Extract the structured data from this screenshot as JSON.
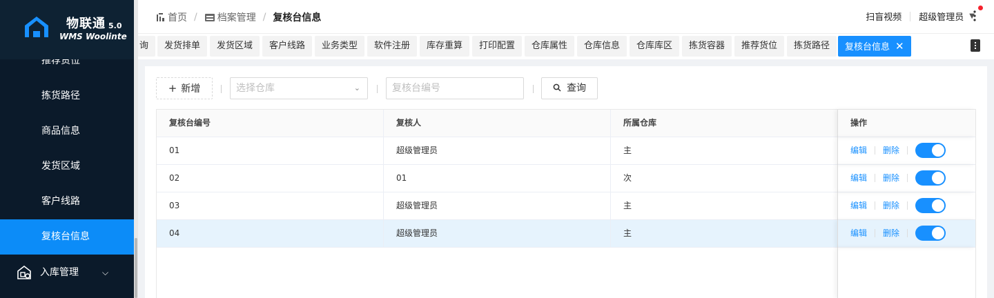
{
  "brand": {
    "name_cn": "物联通",
    "version": "5.0",
    "name_en": "WMS Woolinte"
  },
  "sidebar": {
    "items": [
      {
        "label": "推荐货位"
      },
      {
        "label": "拣货路径"
      },
      {
        "label": "商品信息"
      },
      {
        "label": "发货区域"
      },
      {
        "label": "客户线路"
      },
      {
        "label": "复核台信息",
        "active": true
      }
    ],
    "group": {
      "label": "入库管理",
      "icon": "inbound-icon"
    }
  },
  "breadcrumb": {
    "home": "首页",
    "parent": "档案管理",
    "current": "复核台信息"
  },
  "header": {
    "link": "扫盲视频",
    "user": "超级管理员"
  },
  "tags": [
    "询",
    "发货排单",
    "发货区域",
    "客户线路",
    "业务类型",
    "软件注册",
    "库存重算",
    "打印配置",
    "仓库属性",
    "仓库信息",
    "仓库库区",
    "拣货容器",
    "推荐货位",
    "拣货路径"
  ],
  "active_tag": "复核台信息",
  "toolbar": {
    "add_label": "新增",
    "warehouse_placeholder": "选择仓库",
    "code_placeholder": "复核台编号",
    "query_label": "查询"
  },
  "table": {
    "columns": [
      "复核台编号",
      "复核人",
      "所属仓库",
      "操作"
    ],
    "rows": [
      {
        "code": "01",
        "reviewer": "超级管理员",
        "warehouse": "主",
        "enabled": true
      },
      {
        "code": "02",
        "reviewer": "01",
        "warehouse": "次",
        "enabled": true
      },
      {
        "code": "03",
        "reviewer": "超级管理员",
        "warehouse": "主",
        "enabled": true
      },
      {
        "code": "04",
        "reviewer": "超级管理员",
        "warehouse": "主",
        "enabled": true,
        "selected": true
      }
    ],
    "edit_label": "编辑",
    "delete_label": "删除"
  },
  "colors": {
    "primary": "#1890ff",
    "sidebar": "#0b1a2a",
    "active_menu": "#0c8cf8"
  }
}
